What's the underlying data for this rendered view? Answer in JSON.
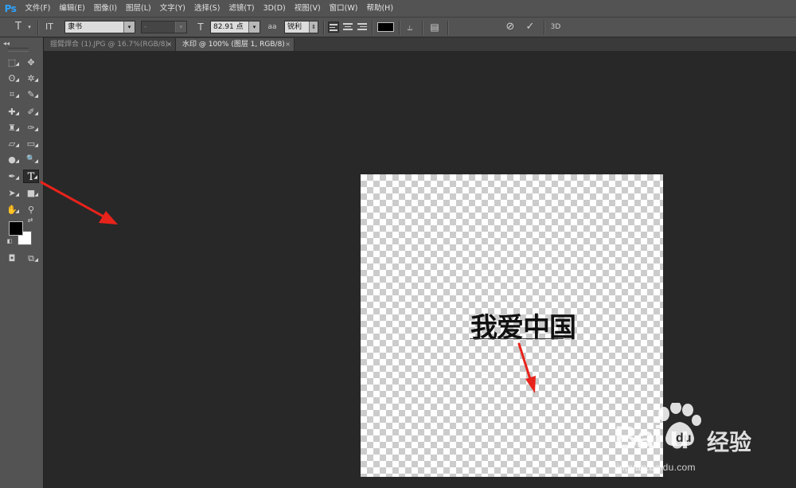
{
  "app": {
    "logo": "Ps",
    "accent": "#2fa3ff"
  },
  "menu": {
    "items": [
      "文件(F)",
      "编辑(E)",
      "图像(I)",
      "图层(L)",
      "文字(Y)",
      "选择(S)",
      "滤镜(T)",
      "3D(D)",
      "视图(V)",
      "窗口(W)",
      "帮助(H)"
    ]
  },
  "options": {
    "tool_icon": "T",
    "orient_icon": "IT",
    "font_family": "隶书",
    "font_style": "-",
    "size_icon": "T",
    "font_size": "82.91 点",
    "aa_icon": "aa",
    "anti_alias": "锐利",
    "text_color": "#000000",
    "cancel_icon": "⊘",
    "commit_icon": "✓",
    "threed_label": "3D"
  },
  "tabs": [
    {
      "label": "揺臂焊合 (1).JPG @ 16.7%(RGB/8)",
      "close": "×",
      "active": false
    },
    {
      "label": "水印 @ 100% (图层 1, RGB/8)",
      "close": "×",
      "active": true
    }
  ],
  "toolbar": {
    "collapse": "◂◂",
    "tools": [
      {
        "name": "marquee-tool",
        "glyph": "⬚"
      },
      {
        "name": "move-tool",
        "glyph": "✥"
      },
      {
        "name": "lasso-tool",
        "glyph": "ʘ"
      },
      {
        "name": "magic-wand-tool",
        "glyph": "✲"
      },
      {
        "name": "crop-tool",
        "glyph": "⌗"
      },
      {
        "name": "eyedropper-tool",
        "glyph": "✎"
      },
      {
        "name": "healing-brush-tool",
        "glyph": "✚"
      },
      {
        "name": "brush-tool",
        "glyph": "✐"
      },
      {
        "name": "clone-stamp-tool",
        "glyph": "♜"
      },
      {
        "name": "history-brush-tool",
        "glyph": "✑"
      },
      {
        "name": "eraser-tool",
        "glyph": "▱"
      },
      {
        "name": "gradient-tool",
        "glyph": "▭"
      },
      {
        "name": "blur-tool",
        "glyph": "●"
      },
      {
        "name": "dodge-tool",
        "glyph": "🔍"
      },
      {
        "name": "pen-tool",
        "glyph": "✒"
      },
      {
        "name": "type-tool",
        "glyph": "T"
      },
      {
        "name": "path-selection-tool",
        "glyph": "➤"
      },
      {
        "name": "rectangle-tool",
        "glyph": "■"
      },
      {
        "name": "hand-tool",
        "glyph": "✋"
      },
      {
        "name": "zoom-tool",
        "glyph": "⚲"
      }
    ],
    "foreground_color": "#000000",
    "background_color": "#ffffff"
  },
  "canvas": {
    "text": "我爱中国",
    "background": "transparent-checkerboard"
  },
  "annotation_arrow_color": "#e8231b",
  "watermark": {
    "brand": "Bai  u",
    "product": "经验",
    "url": "jingyan.baidu.com"
  }
}
